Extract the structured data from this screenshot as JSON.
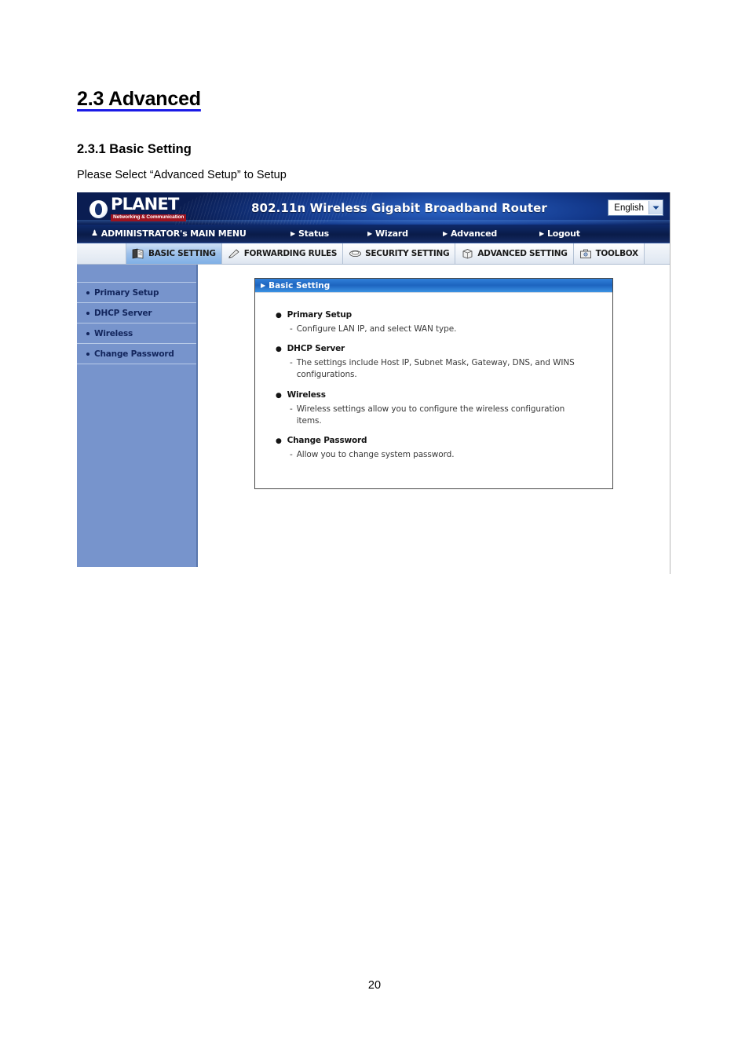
{
  "document": {
    "heading": "2.3 Advanced",
    "subheading": "2.3.1 Basic Setting",
    "intro": "Please Select “Advanced Setup” to Setup",
    "page_number": "20",
    "heading_underline_color": "#1a1ae6"
  },
  "router_ui": {
    "brand": {
      "name": "PLANET",
      "tagline": "Networking & Communication"
    },
    "header": {
      "title": "802.11n Wireless Gigabit Broadband Router",
      "language": "English",
      "language_options": [
        "English"
      ]
    },
    "nav": [
      {
        "label": "ADMINISTRATOR's MAIN MENU",
        "icon": "user-icon"
      },
      {
        "label": "Status",
        "icon": "arrow-right-icon"
      },
      {
        "label": "Wizard",
        "icon": "arrow-right-icon"
      },
      {
        "label": "Advanced",
        "icon": "arrow-right-icon"
      },
      {
        "label": "Logout",
        "icon": "arrow-right-icon"
      }
    ],
    "tabs": [
      {
        "label": "BASIC SETTING",
        "icon": "books-icon",
        "active": true
      },
      {
        "label": "FORWARDING RULES",
        "icon": "pencil-icon",
        "active": false
      },
      {
        "label": "SECURITY SETTING",
        "icon": "shield-icon",
        "active": false
      },
      {
        "label": "ADVANCED SETTING",
        "icon": "gear-box-icon",
        "active": false
      },
      {
        "label": "TOOLBOX",
        "icon": "toolbox-icon",
        "active": false
      }
    ],
    "sidebar": [
      {
        "label": "Primary Setup"
      },
      {
        "label": "DHCP Server"
      },
      {
        "label": "Wireless"
      },
      {
        "label": "Change Password"
      }
    ],
    "panel": {
      "title": "Basic Setting",
      "entries": [
        {
          "title": "Primary Setup",
          "desc": "Configure LAN IP, and select WAN type."
        },
        {
          "title": "DHCP Server",
          "desc": "The settings include Host IP, Subnet Mask, Gateway, DNS, and WINS configurations."
        },
        {
          "title": "Wireless",
          "desc": "Wireless settings allow you to configure the wireless configuration items."
        },
        {
          "title": "Change Password",
          "desc": "Allow you to change system password."
        }
      ]
    },
    "colors": {
      "header_blue": "#0a1d52",
      "sidebar_blue": "#7794cc",
      "panel_head_blue": "#1d64bf",
      "tag_red": "#9c1320"
    }
  }
}
